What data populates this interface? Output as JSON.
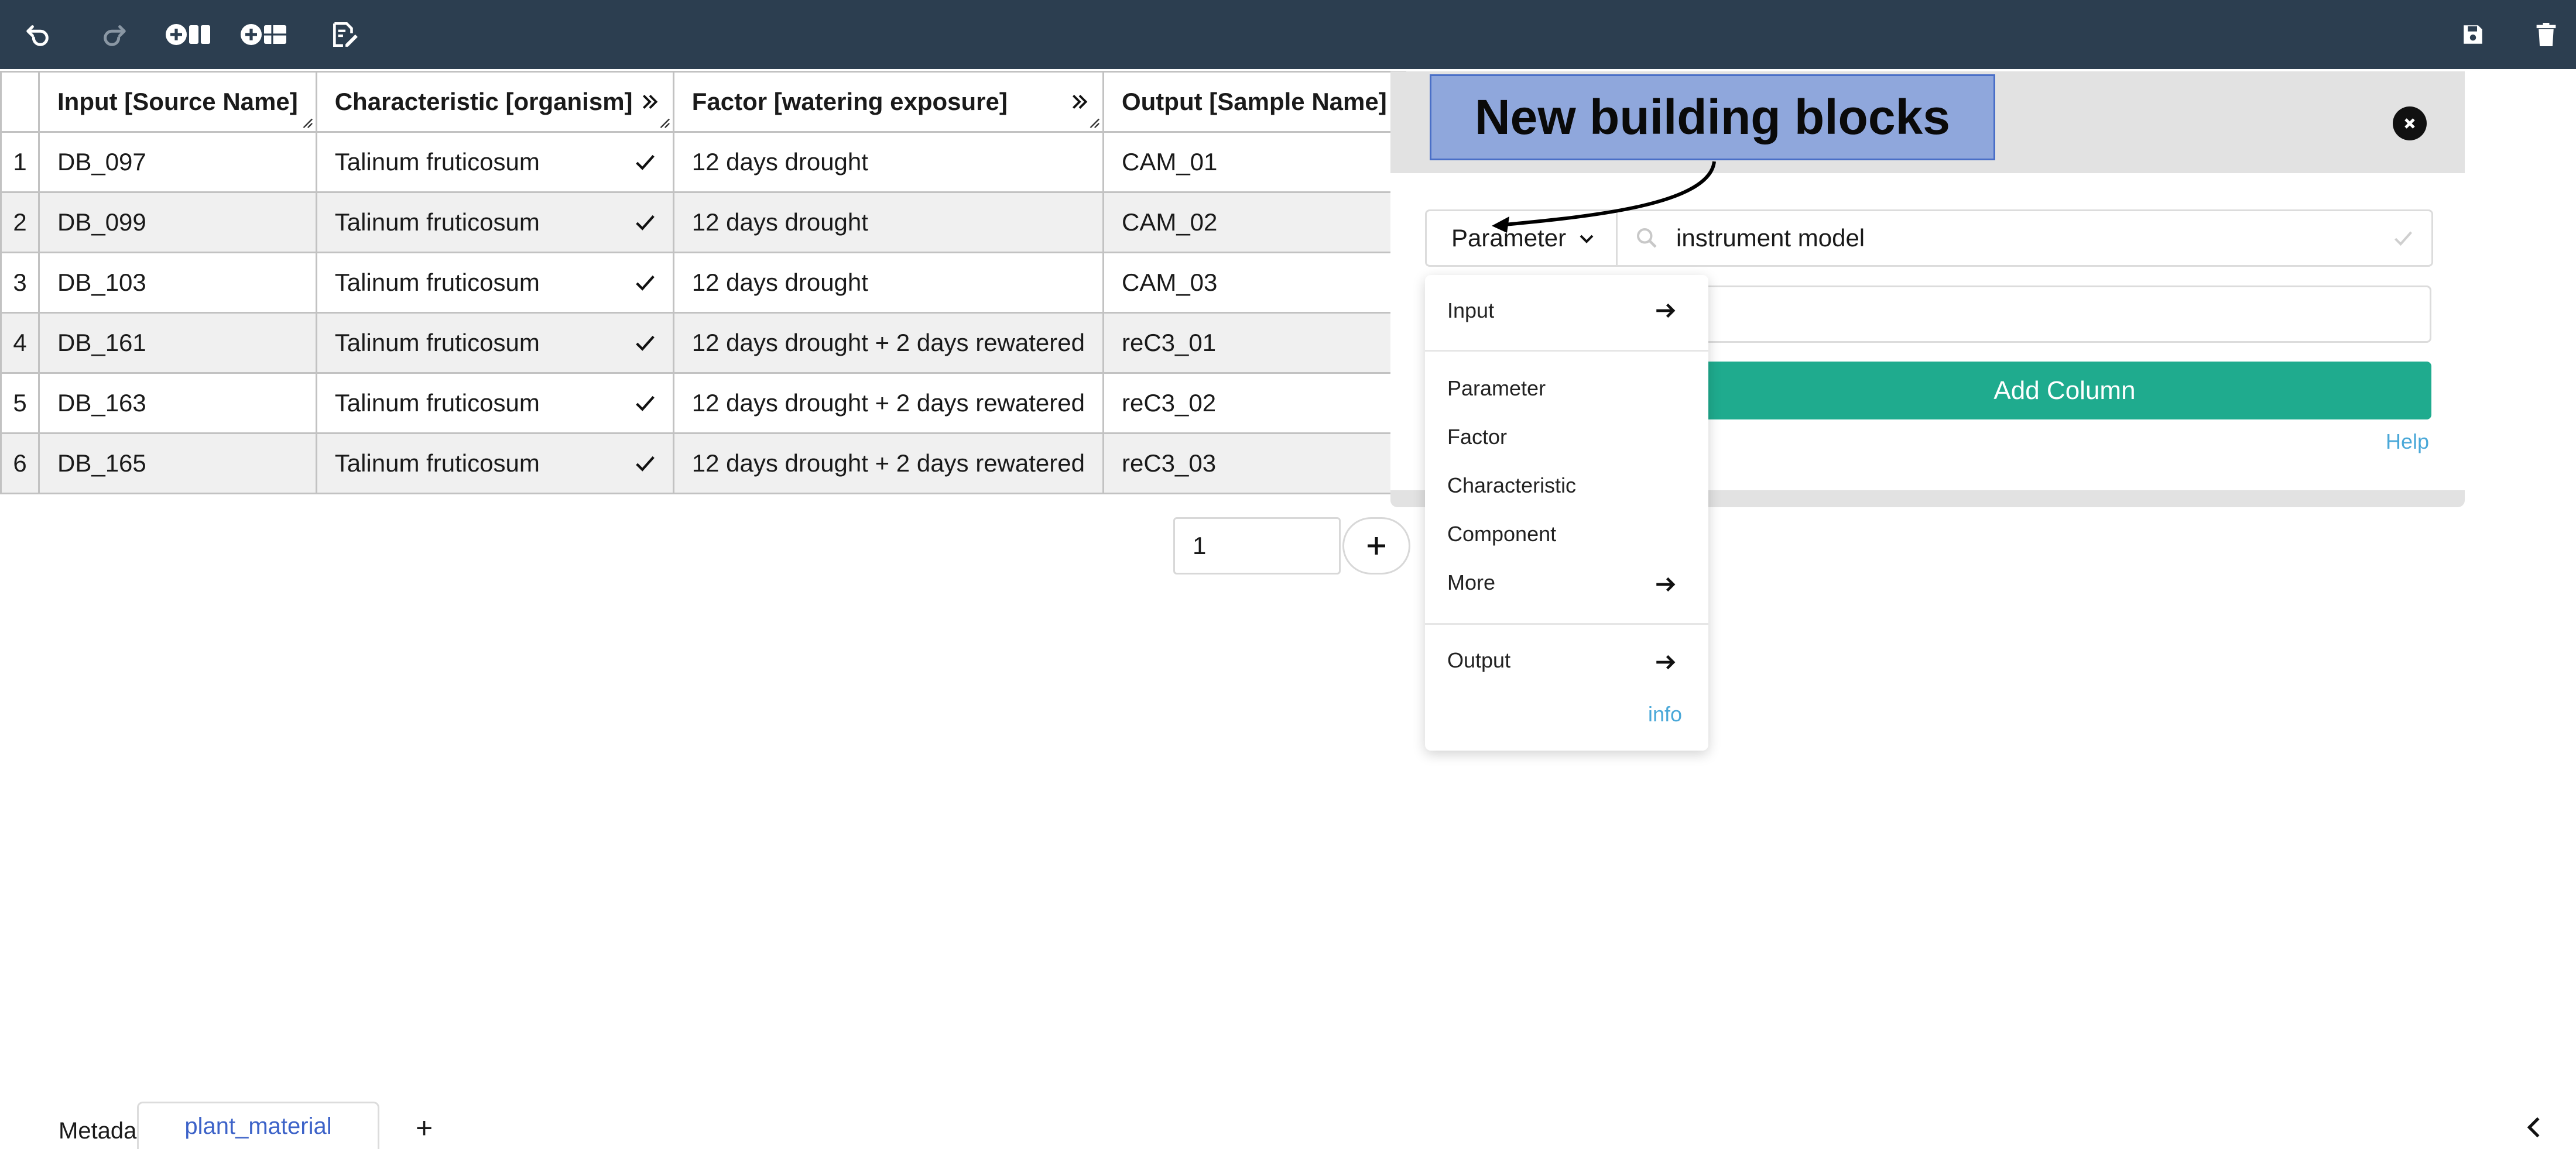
{
  "toolbar": {
    "undo_icon": "undo-icon",
    "redo_icon": "redo-icon",
    "add_column_icon": "add-column-icon",
    "add_table_icon": "add-table-icon",
    "edit_icon": "edit-icon",
    "save_icon": "save-icon",
    "delete_icon": "trash-icon",
    "background": "#2c3e50"
  },
  "table": {
    "headers": [
      "Input [Source Name]",
      "Characteristic [organism]",
      "Factor [watering exposure]",
      "Output [Sample Name]"
    ],
    "rows": [
      {
        "num": "1",
        "input": "DB_097",
        "organism": "Talinum fruticosum",
        "factor": "12 days drought",
        "output": "CAM_01"
      },
      {
        "num": "2",
        "input": "DB_099",
        "organism": "Talinum fruticosum",
        "factor": "12 days drought",
        "output": "CAM_02"
      },
      {
        "num": "3",
        "input": "DB_103",
        "organism": "Talinum fruticosum",
        "factor": "12 days drought",
        "output": "CAM_03"
      },
      {
        "num": "4",
        "input": "DB_161",
        "organism": "Talinum fruticosum",
        "factor": "12 days drought + 2 days rewatered",
        "output": "reC3_01"
      },
      {
        "num": "5",
        "input": "DB_163",
        "organism": "Talinum fruticosum",
        "factor": "12 days drought + 2 days rewatered",
        "output": "reC3_02"
      },
      {
        "num": "6",
        "input": "DB_165",
        "organism": "Talinum fruticosum",
        "factor": "12 days drought + 2 days rewatered",
        "output": "reC3_03"
      }
    ]
  },
  "pager": {
    "rows_to_add": "1"
  },
  "panel": {
    "callout": "New building blocks",
    "type_selected": "Parameter",
    "search_value": "instrument model",
    "add_column_label": "Add Column",
    "help_label": "Help",
    "accent": "#1fab8e"
  },
  "menu": {
    "input": "Input",
    "parameter": "Parameter",
    "factor": "Factor",
    "characteristic": "Characteristic",
    "component": "Component",
    "more": "More",
    "output": "Output",
    "info": "info"
  },
  "tabs": {
    "metadata": "Metadata",
    "active": "plant_material",
    "add": "+"
  }
}
